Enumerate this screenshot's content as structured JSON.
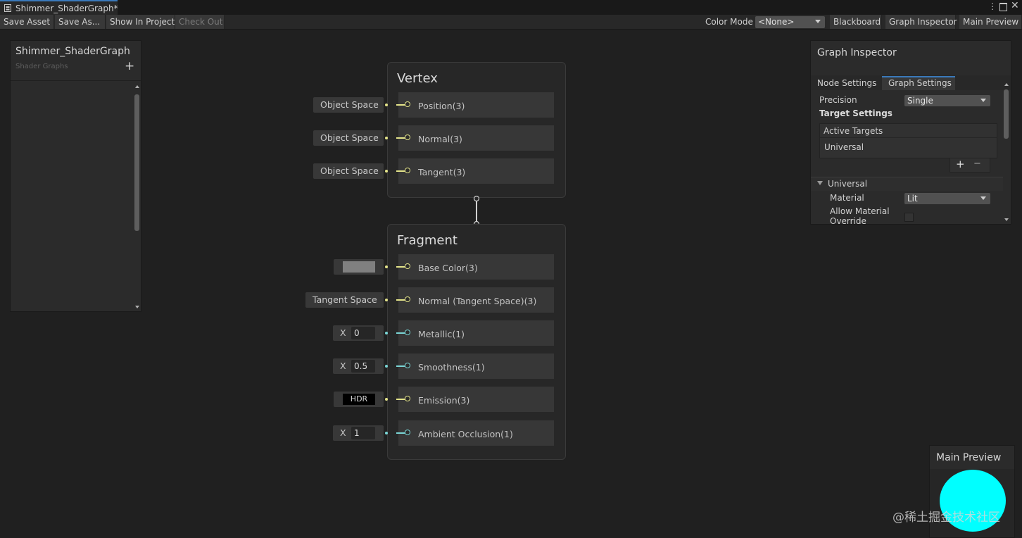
{
  "window": {
    "tab_title": "Shimmer_ShaderGraph*"
  },
  "toolbar": {
    "save_asset": "Save Asset",
    "save_as": "Save As...",
    "show_in_project": "Show In Project",
    "check_out": "Check Out",
    "color_mode_label": "Color Mode",
    "color_mode_value": "<None>",
    "blackboard": "Blackboard",
    "graph_inspector": "Graph Inspector",
    "main_preview": "Main Preview"
  },
  "blackboard": {
    "title": "Shimmer_ShaderGraph",
    "subtitle": "Shader Graphs",
    "add": "+"
  },
  "vertex": {
    "title": "Vertex",
    "slots": [
      {
        "label": "Position(3)",
        "input": "Object Space"
      },
      {
        "label": "Normal(3)",
        "input": "Object Space"
      },
      {
        "label": "Tangent(3)",
        "input": "Object Space"
      }
    ]
  },
  "fragment": {
    "title": "Fragment",
    "slots": [
      {
        "label": "Base Color(3)",
        "input_color": "#808080"
      },
      {
        "label": "Normal (Tangent Space)(3)",
        "input": "Tangent Space"
      },
      {
        "label": "Metallic(1)",
        "x_label": "X",
        "value": "0"
      },
      {
        "label": "Smoothness(1)",
        "x_label": "X",
        "value": "0.5"
      },
      {
        "label": "Emission(3)",
        "input": "HDR"
      },
      {
        "label": "Ambient Occlusion(1)",
        "x_label": "X",
        "value": "1"
      }
    ]
  },
  "inspector": {
    "title": "Graph Inspector",
    "tabs": [
      "Node Settings",
      "Graph Settings"
    ],
    "active_tab": "Graph Settings",
    "precision_label": "Precision",
    "precision_value": "Single",
    "target_settings": "Target Settings",
    "active_targets": "Active Targets",
    "targets": [
      "Universal"
    ],
    "add_btn": "+",
    "remove_btn": "−",
    "section": "Universal",
    "material_label": "Material",
    "material_value": "Lit",
    "allow_override_line1": "Allow Material",
    "allow_override_line2": "Override"
  },
  "preview": {
    "title": "Main Preview",
    "color": "#00ffff"
  },
  "watermark": "@稀土掘金技术社区",
  "colors": {
    "vector3_port": "#e4e48a",
    "float_port": "#7ad6d6",
    "accent": "#3a79bb"
  }
}
